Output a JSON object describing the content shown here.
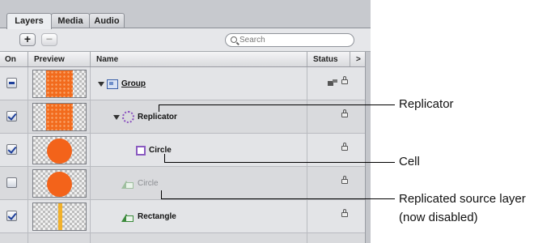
{
  "tabs": [
    {
      "label": "Layers",
      "active": true
    },
    {
      "label": "Media",
      "active": false
    },
    {
      "label": "Audio",
      "active": false
    }
  ],
  "toolbar": {
    "add_label": "+",
    "remove_label": "−",
    "search_placeholder": "Search"
  },
  "columns": {
    "on": "On",
    "preview": "Preview",
    "name": "Name",
    "status": "Status",
    "more": ">"
  },
  "layers": [
    {
      "name": "Group",
      "checked": "mixed",
      "expanded": true,
      "icon": "group-icon",
      "preview": "orange-pattern",
      "status_icons": [
        "group-status-icon",
        "lock-icon"
      ]
    },
    {
      "name": "Replicator",
      "checked": "checked",
      "expanded": true,
      "icon": "replicator-icon",
      "preview": "orange-pattern",
      "status_icons": [
        "lock-icon"
      ]
    },
    {
      "name": "Circle",
      "checked": "checked",
      "expanded": false,
      "icon": "cell-icon",
      "preview": "orange-circle",
      "status_icons": [
        "lock-icon"
      ]
    },
    {
      "name": "Circle",
      "checked": "unchecked",
      "expanded": false,
      "icon": "shape-icon",
      "preview": "orange-circle",
      "status_icons": [
        "lock-icon"
      ],
      "disabled": true
    },
    {
      "name": "Rectangle",
      "checked": "checked",
      "expanded": false,
      "icon": "shape-icon",
      "preview": "yellow-bar",
      "status_icons": [
        "lock-icon"
      ]
    }
  ],
  "callouts": {
    "replicator": "Replicator",
    "cell": "Cell",
    "source_line1": "Replicated source layer",
    "source_line2": "(now disabled)"
  }
}
